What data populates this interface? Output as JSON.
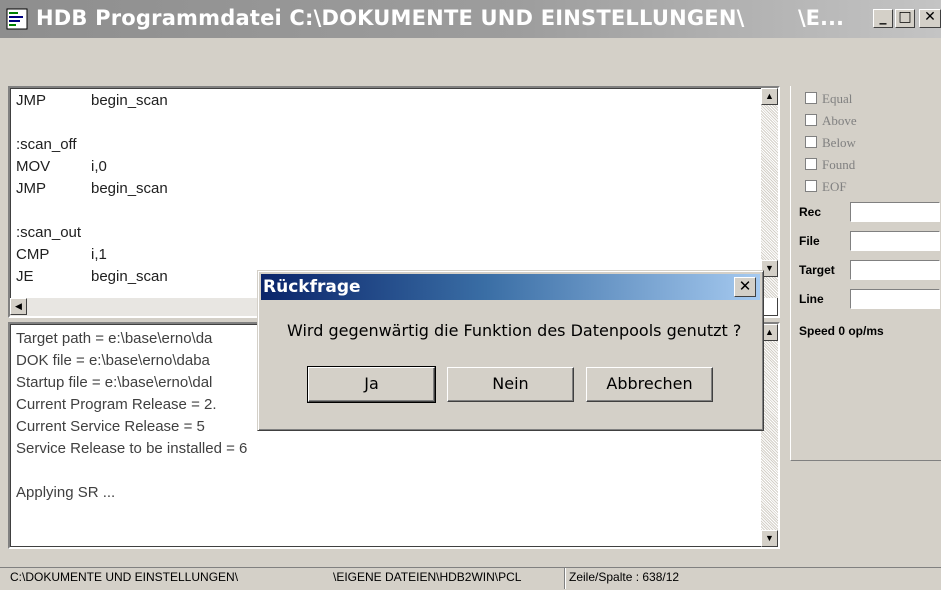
{
  "window": {
    "title": "HDB Programmdatei C:\\DOKUMENTE UND EINSTELLUNGEN\\",
    "title_tail": "\\E...",
    "icon": "program-icon",
    "controls": {
      "minimize": "_",
      "maximize": "□",
      "close": "✕"
    }
  },
  "code_lines": [
    {
      "op": "JMP",
      "arg": "begin_scan"
    },
    {
      "op": "",
      "arg": ""
    },
    {
      "op": ":scan_off",
      "arg": ""
    },
    {
      "op": "MOV",
      "arg": "i,0"
    },
    {
      "op": "JMP",
      "arg": "begin_scan"
    },
    {
      "op": "",
      "arg": ""
    },
    {
      "op": ":scan_out",
      "arg": ""
    },
    {
      "op": "CMP",
      "arg": "i,1"
    },
    {
      "op": "JE",
      "arg": "begin_scan"
    }
  ],
  "log_lines": [
    "Target path = e:\\base\\erno\\da",
    "DOK file = e:\\base\\erno\\daba",
    "Startup file = e:\\base\\erno\\dal",
    "Current Program Release = 2.",
    "Current Service Release = 5",
    "Service Release to be installed = 6",
    "",
    "Applying SR ..."
  ],
  "right_panel": {
    "checkboxes": [
      "Equal",
      "Above",
      "Below",
      "Found",
      "EOF"
    ],
    "fields": [
      {
        "label": "Rec",
        "value": ""
      },
      {
        "label": "File",
        "value": ""
      },
      {
        "label": "Target",
        "value": ""
      },
      {
        "label": "Line",
        "value": ""
      }
    ],
    "speed": "Speed 0 op/ms"
  },
  "status_bar": {
    "path": "C:\\DOKUMENTE UND EINSTELLUNGEN\\",
    "path_tail": "\\EIGENE DATEIEN\\HDB2WIN\\PCL",
    "position": "Zeile/Spalte : 638/12"
  },
  "dialog": {
    "title": "Rückfrage",
    "message": "Wird gegenwärtig die Funktion des Datenpools genutzt ?",
    "buttons": {
      "yes": "Ja",
      "no": "Nein",
      "cancel": "Abbrechen"
    }
  },
  "colors": {
    "dialog_title": "#0a246a",
    "window_face": "#d4d0c8"
  }
}
